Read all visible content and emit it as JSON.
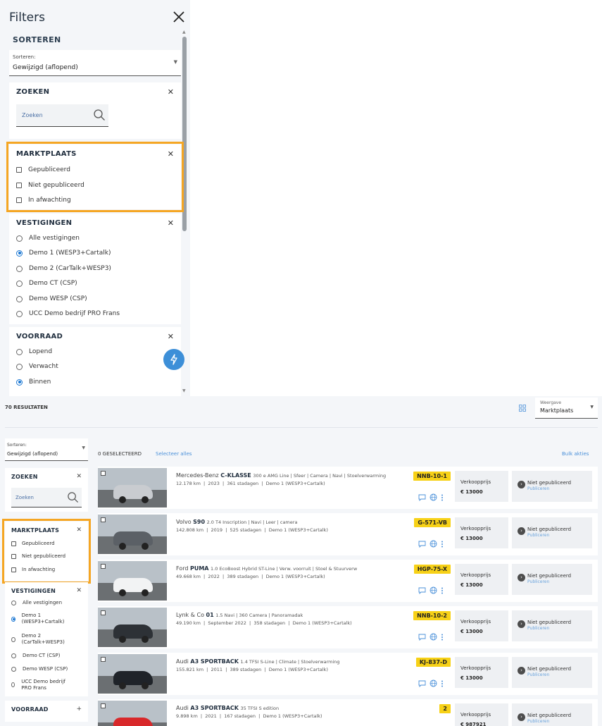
{
  "filter_panel": {
    "title": "Filters",
    "sort_heading": "SORTEREN",
    "sort_label": "Sorteren:",
    "sort_value": "Gewijzigd (aflopend)",
    "search": {
      "heading": "ZOEKEN",
      "placeholder": "Zoeken"
    },
    "marktplaats": {
      "heading": "MARKTPLAATS",
      "options": [
        "Gepubliceerd",
        "Niet gepubliceerd",
        "In afwachting"
      ]
    },
    "vestigingen": {
      "heading": "VESTIGINGEN",
      "options": [
        "Alle vestigingen",
        "Demo 1 (WESP3+Cartalk)",
        "Demo 2 (CarTalk+WESP3)",
        "Demo CT (CSP)",
        "Demo WESP (CSP)",
        "UCC Demo bedrijf PRO Frans"
      ],
      "selected": 1
    },
    "voorraad": {
      "heading": "VOORRAAD",
      "options": [
        "Lopend",
        "Verwacht",
        "Binnen"
      ],
      "selected": 2
    }
  },
  "results": {
    "count_label": "70 RESULTATEN",
    "view_label": "Weergave",
    "view_value": "Marktplaats",
    "sort_label": "Sorteren:",
    "sort_value": "Gewijzigd (aflopend)",
    "selected_label": "0 GESELECTEERD",
    "select_all": "Selecteer alles",
    "bulk": "Bulk akties",
    "sidebar": {
      "search_heading": "ZOEKEN",
      "search_placeholder": "Zoeken",
      "marktplaats_heading": "MARKTPLAATS",
      "marktplaats_options": [
        "Gepubliceerd",
        "Niet gepubliceerd",
        "In afwachting"
      ],
      "vestigingen_heading": "VESTIGINGEN",
      "vestigingen_options": [
        "Alle vestigingen",
        "Demo 1 (WESP3+Cartalk)",
        "Demo 2 (CarTalk+WESP3)",
        "Demo CT (CSP)",
        "Demo WESP (CSP)",
        "UCC Demo bedrijf PRO Frans"
      ],
      "voorraad_heading": "VOORRAAD"
    },
    "cars": [
      {
        "make": "Mercedes-Benz",
        "model": "C-KLASSE",
        "spec": "300 e AMG Line | Sfeer | Camera | Navi | Stoelverwarming",
        "km": "12.178 km",
        "year": "2023",
        "days": "361 stadagen",
        "location": "Demo 1 (WESP3+Cartalk)",
        "plate": "NNB-10-1",
        "price_label": "Verkoopprijs",
        "price": "€ 13000",
        "status": "Niet gepubliceerd",
        "action": "Publiceren",
        "color": "#c9ccd0"
      },
      {
        "make": "Volvo",
        "model": "S90",
        "spec": "2.0 T4 Inscription | Navi | Leer | camera",
        "km": "142.808 km",
        "year": "2019",
        "days": "525 stadagen",
        "location": "Demo 1 (WESP3+Cartalk)",
        "plate": "G-571-VB",
        "price_label": "Verkoopprijs",
        "price": "€ 13000",
        "status": "Niet gepubliceerd",
        "action": "Publiceren",
        "color": "#5b6066"
      },
      {
        "make": "Ford",
        "model": "PUMA",
        "spec": "1.0 EcoBoost Hybrid ST-Line | Verw. voorruit | Stoel & Stuurverw",
        "km": "49.668 km",
        "year": "2022",
        "days": "389 stadagen",
        "location": "Demo 1 (WESP3+Cartalk)",
        "plate": "HGP-75-X",
        "price_label": "Verkoopprijs",
        "price": "€ 13000",
        "status": "Niet gepubliceerd",
        "action": "Publiceren",
        "color": "#f2f3f4"
      },
      {
        "make": "Lynk & Co",
        "model": "01",
        "spec": "1.5 Navi | 360 Camera | Panoramadak",
        "km": "49.190 km",
        "year": "September 2022",
        "days": "358 stadagen",
        "location": "Demo 1 (WESP3+Cartalk)",
        "plate": "NNB-10-2",
        "price_label": "Verkoopprijs",
        "price": "€ 13000",
        "status": "Niet gepubliceerd",
        "action": "Publiceren",
        "color": "#2d3136"
      },
      {
        "make": "Audi",
        "model": "A3 SPORTBACK",
        "spec": "1.4 TFSI S-Line | Climate | Stoelverwarming",
        "km": "155.821 km",
        "year": "2011",
        "days": "389 stadagen",
        "location": "Demo 1 (WESP3+Cartalk)",
        "plate": "KJ-837-D",
        "price_label": "Verkoopprijs",
        "price": "€ 13000",
        "status": "Niet gepubliceerd",
        "action": "Publiceren",
        "color": "#1f2329"
      },
      {
        "make": "Audi",
        "model": "A3 SPORTBACK",
        "spec": "35 TFSI S edition",
        "km": "9.898 km",
        "year": "2021",
        "days": "167 stadagen",
        "location": "Demo 1 (WESP3+Cartalk)",
        "plate": "2",
        "price_label": "Verkoopprijs",
        "price": "€ 987921",
        "status": "Niet gepubliceerd",
        "action": "Publiceren",
        "color": "#d8282a"
      }
    ]
  },
  "colors": {
    "accent": "#4a90d9",
    "highlight": "#f5a623",
    "plate": "#f7d117",
    "fab": "#3d8fd8"
  },
  "icons": [
    "close-icon",
    "search-icon",
    "chevron-down-icon",
    "grid-icon",
    "flash-icon",
    "chat-icon",
    "globe-icon",
    "more-vertical-icon",
    "arrow-right-icon"
  ]
}
